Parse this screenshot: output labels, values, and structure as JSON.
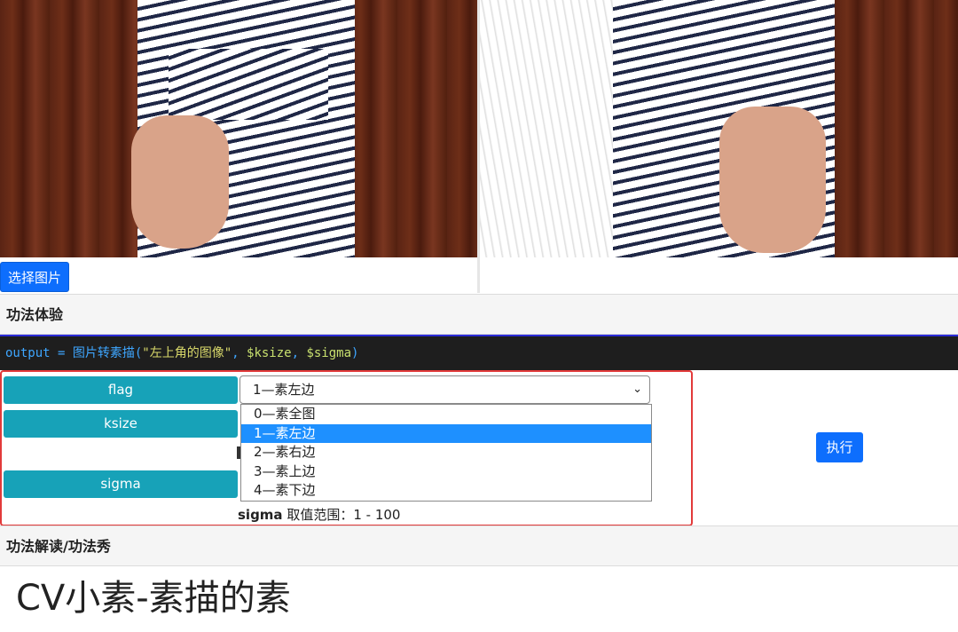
{
  "choose_button": "选择图片",
  "section_experience": "功法体验",
  "code": {
    "lhs": "output = 图片转素描(",
    "arg_string": "\"左上角的图像\"",
    "sep1": ", ",
    "arg_ksize": "$ksize",
    "sep2": ", ",
    "arg_sigma": "$sigma",
    "close": ")"
  },
  "params": {
    "flag_label": "flag",
    "ksize_label": "ksize",
    "sigma_label": "sigma",
    "flag_selected": "1—素左边",
    "flag_options": [
      "0—素全图",
      "1—素左边",
      "2—素右边",
      "3—素上边",
      "4—素下边"
    ],
    "sigma_range_label": "sigma",
    "sigma_range_text": " 取值范围：1 - 100"
  },
  "execute_button": "执行",
  "section_explain": "功法解读/功法秀",
  "article_title": "CV小素-素描的素",
  "colors": {
    "primary": "#0d6efd",
    "param_button": "#17a2b8",
    "highlight_border": "#e23a3a",
    "selected_option": "#1e90ff"
  },
  "icons": {
    "select_chevron": "chevron-down-icon"
  }
}
